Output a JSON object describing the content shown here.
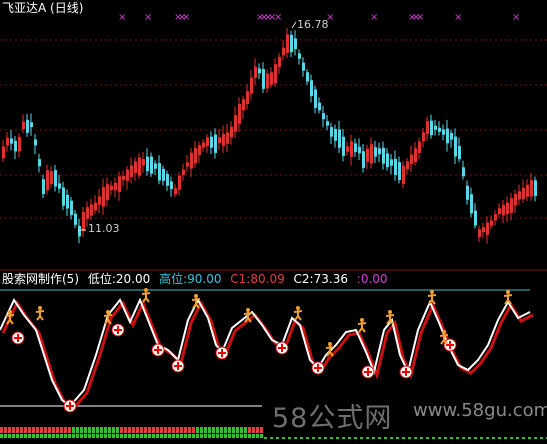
{
  "title": "飞亚达A (日线)",
  "price_high_label": "16.78",
  "price_low_label": "11.03",
  "indicator": {
    "name": "股索网制作(5)",
    "low_label": "低位:20.00",
    "high_label": "高位:90.00",
    "c1_label": "C1:80.09",
    "c2_label": "C2:73.36",
    "last_label": ":0.00"
  },
  "watermark": {
    "brand": "58公式网",
    "url": "www.58gu.com"
  },
  "colors": {
    "background": "#000000",
    "up": "#e03030",
    "down": "#58d8e8",
    "grid": "#7a1010",
    "magenta": "#d040d0",
    "cyan_line": "#40c0c0",
    "orange": "#f0a030",
    "indicator_line": "#ffffff",
    "indicator_shadow": "#cc1010"
  },
  "chart_data": {
    "type": "candlestick",
    "price_high": 16.78,
    "price_low": 11.03,
    "indicator_levels": {
      "low": 20.0,
      "high": 90.0,
      "c1": 80.09,
      "c2": 73.36
    }
  }
}
